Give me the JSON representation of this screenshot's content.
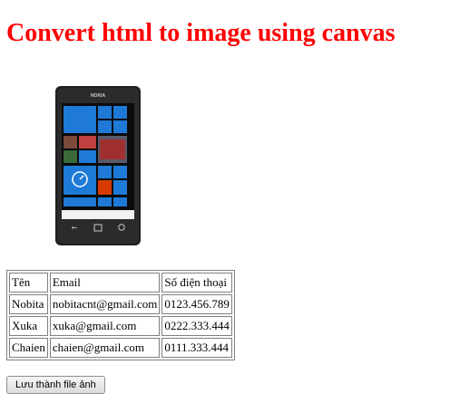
{
  "page": {
    "title": "Convert html to image using canvas",
    "title_color": "#ff0000"
  },
  "phone_image": {
    "icon": "smartphone-image",
    "brand": "NOKIA"
  },
  "table": {
    "headers": [
      "Tên",
      "Email",
      "Số điện thoại"
    ],
    "rows": [
      [
        "Nobita",
        "nobitacnt@gmail.com",
        "0123.456.789"
      ],
      [
        "Xuka",
        "xuka@gmail.com",
        "0222.333.444"
      ],
      [
        "Chaien",
        "chaien@gmail.com",
        "0111.333.444"
      ]
    ]
  },
  "actions": {
    "save_label": "Lưu thành file ảnh"
  }
}
